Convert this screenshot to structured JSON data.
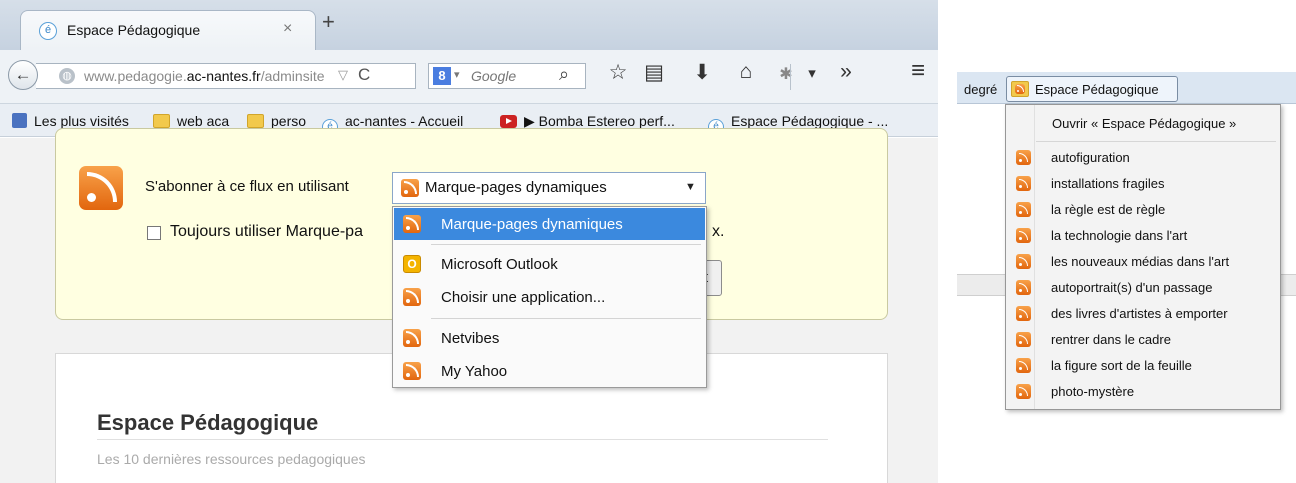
{
  "tab": {
    "title": "Espace Pédagogique",
    "close": "×",
    "new_tab": "+"
  },
  "navbar": {
    "back": "←",
    "url_prefix": "www.pedagogie.",
    "url_domain": "ac-nantes.fr",
    "url_suffix": "/adminsite",
    "url_dropdown": "▽",
    "reload": "C",
    "search_engine": "8",
    "search_dropdown": "▾",
    "search_placeholder": "Google",
    "search_icon": "⌕",
    "toolbar": {
      "star": "☆",
      "list": "▤",
      "download": "⬇",
      "home": "⌂",
      "addon": "✱",
      "more": "▾",
      "overflow": "»",
      "menu": "≡"
    }
  },
  "bookmarks": [
    {
      "label": "Les plus visités",
      "icon": "most-visited-icon"
    },
    {
      "label": "web aca",
      "icon": "folder-icon"
    },
    {
      "label": "perso",
      "icon": "folder-icon"
    },
    {
      "label": "ac-nantes - Accueil",
      "icon": "site-icon"
    },
    {
      "label": "▶ Bomba Estereo perf...",
      "icon": "youtube-icon"
    },
    {
      "label": "Espace Pédagogique - ...",
      "icon": "site-icon"
    }
  ],
  "feed": {
    "subscribe_label": "S'abonner à ce flux en utilisant",
    "selected": "Marque-pages dynamiques",
    "always_label": "Toujours utiliser Marque-pa",
    "always_tail": "x.",
    "button_partial": "t",
    "options": [
      {
        "label": "Marque-pages dynamiques",
        "icon": "rss-icon",
        "selected": true
      },
      {
        "label": "Microsoft Outlook",
        "icon": "outlook-icon",
        "selected": false
      },
      {
        "label": "Choisir une application...",
        "icon": "rss-icon",
        "selected": false
      },
      {
        "label": "Netvibes",
        "icon": "rss-icon",
        "selected": false
      },
      {
        "label": "My Yahoo",
        "icon": "rss-icon",
        "selected": false
      }
    ]
  },
  "article": {
    "title": "Espace Pédagogique",
    "subtitle": "Les 10 dernières ressources pedagogiques"
  },
  "live_menu": {
    "toolbar_prefix": "degré",
    "folder_label": "Espace Pédagogique",
    "open_all": "Ouvrir « Espace Pédagogique »",
    "items": [
      "autofiguration",
      "installations fragiles",
      "la règle est de règle",
      "la technologie dans l'art",
      "les nouveaux médias dans l'art",
      "autoportrait(s) d'un passage",
      "des livres d'artistes à emporter",
      "rentrer dans le cadre",
      "la figure sort de la feuille",
      "photo-mystère"
    ]
  },
  "colors": {
    "accent": "#3b89de",
    "feed_bg": "#ffffe1",
    "rss": "#e2660e"
  }
}
